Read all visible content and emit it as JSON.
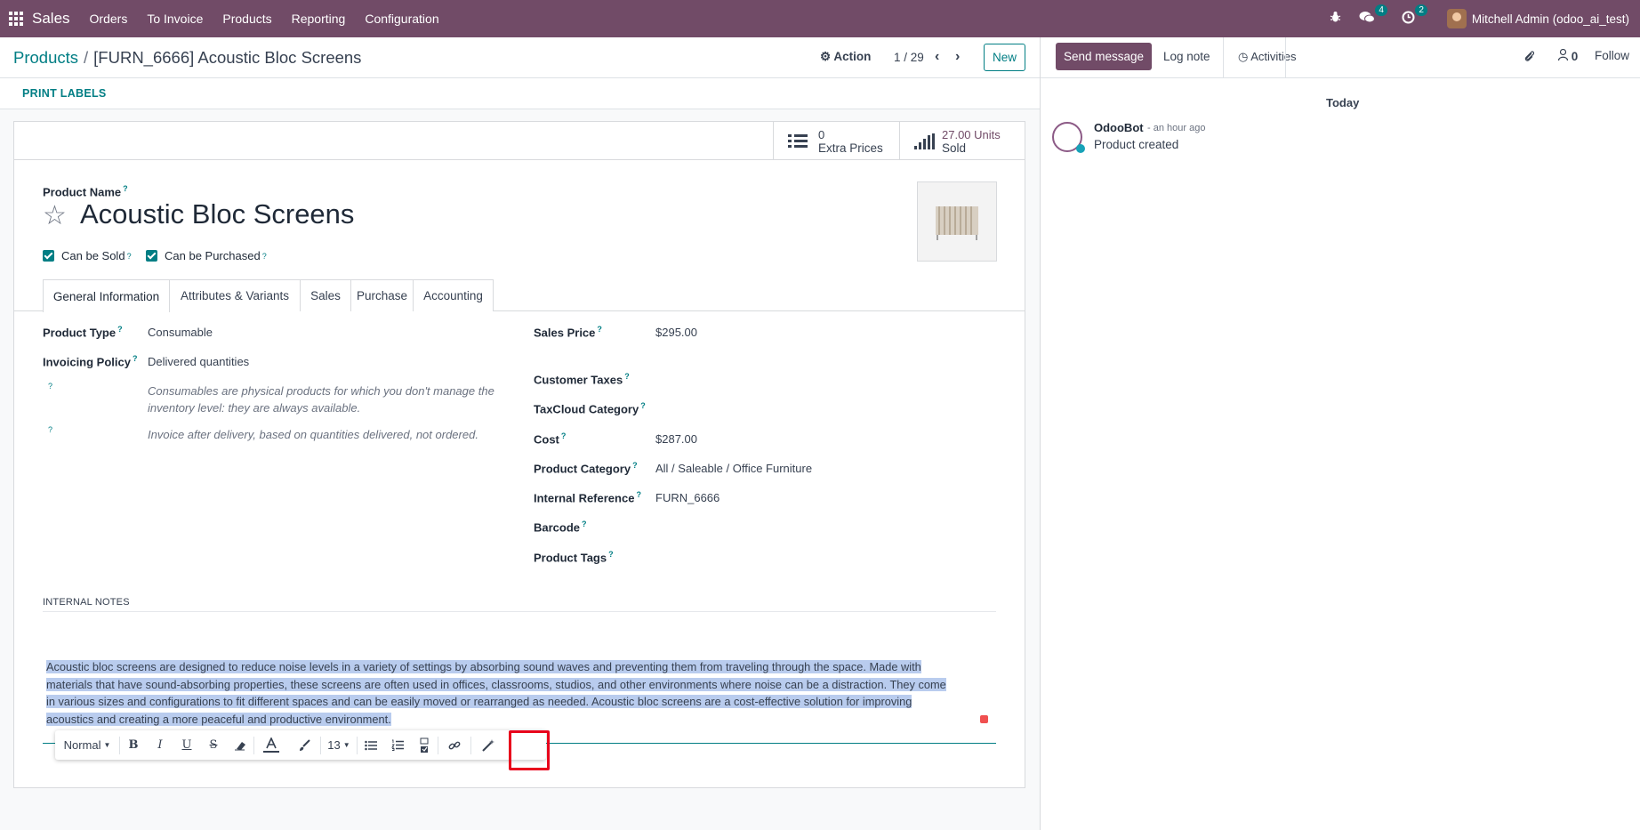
{
  "navbar": {
    "brand": "Sales",
    "menu": [
      "Orders",
      "To Invoice",
      "Products",
      "Reporting",
      "Configuration"
    ],
    "messages_count": "4",
    "activities_count": "2",
    "user": "Mitchell Admin (odoo_ai_test)"
  },
  "control": {
    "breadcrumb_parent": "Products",
    "breadcrumb_current": "[FURN_6666] Acoustic Bloc Screens",
    "action_label": "Action",
    "pager": "1 / 29",
    "new_label": "New",
    "print_labels": "PRINT LABELS"
  },
  "stats": {
    "extra_prices_value": "0",
    "extra_prices_label": "Extra Prices",
    "sold_value": "27.00 Units",
    "sold_label": "Sold"
  },
  "product": {
    "name_label": "Product Name",
    "name": "Acoustic Bloc Screens",
    "can_be_sold": "Can be Sold",
    "can_be_purchased": "Can be Purchased"
  },
  "tabs": [
    "General Information",
    "Attributes & Variants",
    "Sales",
    "Purchase",
    "Accounting"
  ],
  "general": {
    "product_type_label": "Product Type",
    "product_type": "Consumable",
    "invoicing_policy_label": "Invoicing Policy",
    "invoicing_policy": "Delivered quantities",
    "help_consumable": "Consumables are physical products for which you don't manage the inventory level: they are always available.",
    "help_invoice": "Invoice after delivery, based on quantities delivered, not ordered.",
    "sales_price_label": "Sales Price",
    "sales_price": "$295.00",
    "customer_taxes_label": "Customer Taxes",
    "taxcloud_label": "TaxCloud Category",
    "cost_label": "Cost",
    "cost": "$287.00",
    "category_label": "Product Category",
    "category": "All / Saleable / Office Furniture",
    "internal_ref_label": "Internal Reference",
    "internal_ref": "FURN_6666",
    "barcode_label": "Barcode",
    "tags_label": "Product Tags"
  },
  "notes": {
    "heading": "INTERNAL NOTES",
    "line1": "Acoustic bloc screens are designed to reduce noise levels in a variety of settings by absorbing sound waves and preventing them from traveling through the space. Made with",
    "line2": "materials that have sound-absorbing properties, these screens are often used in offices, classrooms, studios, and other environments where noise can be a distraction. They come",
    "line3": "in various sizes and configurations to fit different spaces and can be easily moved or rearranged as needed. Acoustic bloc screens are a cost-effective solution for improving",
    "line4": "acoustics and creating a more peaceful and productive environment."
  },
  "toolbar": {
    "style": "Normal",
    "font_size": "13",
    "bold": "B",
    "italic": "I",
    "underline": "U",
    "strike": "S"
  },
  "chatter": {
    "send_message": "Send message",
    "log_note": "Log note",
    "activities": "Activities",
    "followers_count": "0",
    "follow": "Follow",
    "today": "Today",
    "author": "OdooBot",
    "time": "- an hour ago",
    "body": "Product created"
  },
  "colors": {
    "navbar": "#714b67",
    "accent": "#017e84",
    "highlight": "#b9ccee"
  }
}
